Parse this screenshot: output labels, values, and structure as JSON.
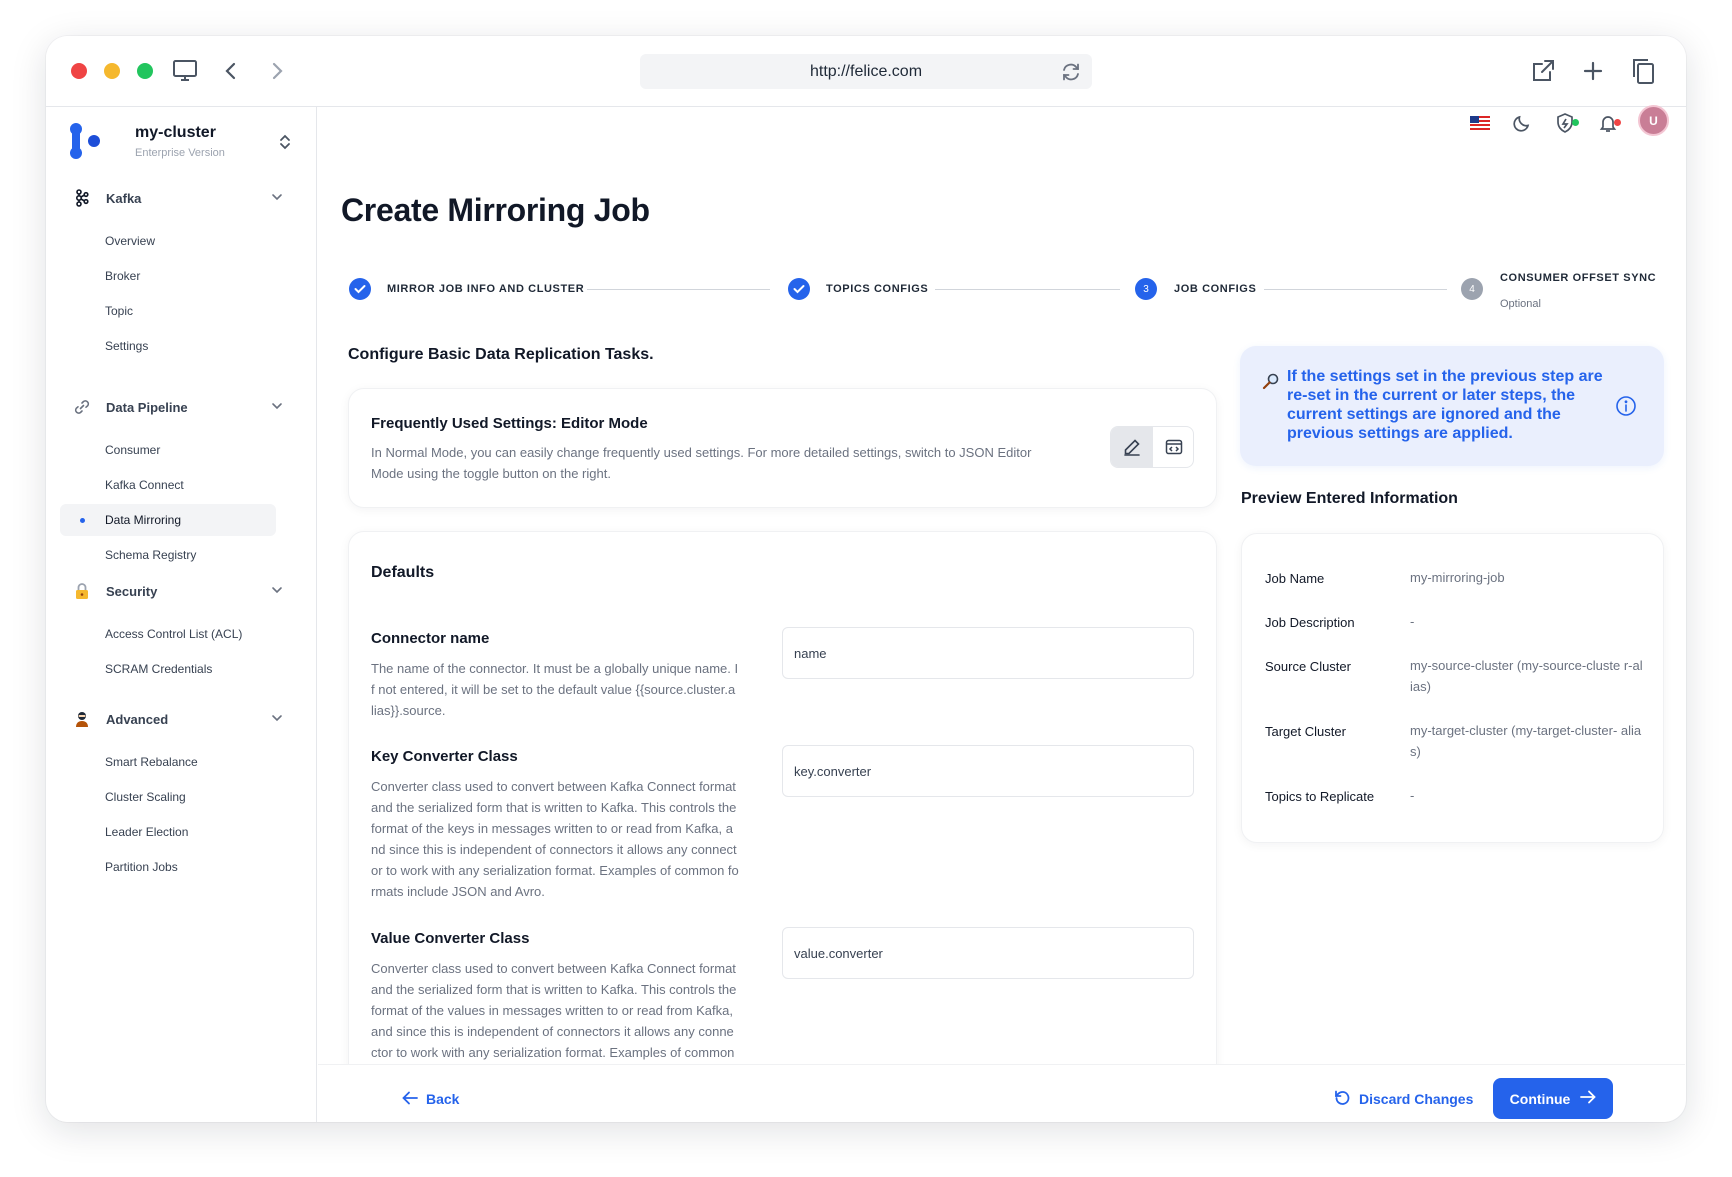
{
  "browser": {
    "url": "http://felice.com"
  },
  "sidebar": {
    "cluster_name": "my-cluster",
    "cluster_edition": "Enterprise Version",
    "sections": [
      {
        "label": "Kafka",
        "items": [
          "Overview",
          "Broker",
          "Topic",
          "Settings"
        ]
      },
      {
        "label": "Data Pipeline",
        "items": [
          "Consumer",
          "Kafka Connect",
          "Data Mirroring",
          "Schema Registry"
        ]
      },
      {
        "label": "Security",
        "items": [
          "Access Control List (ACL)",
          "SCRAM Credentials"
        ]
      },
      {
        "label": "Advanced",
        "items": [
          "Smart Rebalance",
          "Cluster Scaling",
          "Leader Election",
          "Partition Jobs"
        ]
      }
    ],
    "active_item": "Data Mirroring"
  },
  "topbar": {
    "avatar_initial": "U",
    "icons": [
      "us-flag-icon",
      "moon-icon",
      "shield-icon",
      "bell-icon"
    ]
  },
  "page": {
    "title": "Create Mirroring Job"
  },
  "stepper": {
    "steps": [
      {
        "label": "MIRROR JOB INFO AND CLUSTER",
        "status": "done"
      },
      {
        "label": "TOPICS CONFIGS",
        "status": "done"
      },
      {
        "label": "JOB CONFIGS",
        "status": "current",
        "number": "3"
      },
      {
        "label": "CONSUMER OFFSET SYNC",
        "status": "todo",
        "number": "4",
        "sub": "Optional"
      }
    ]
  },
  "main": {
    "section_heading": "Configure Basic Data Replication Tasks.",
    "editor_card": {
      "title": "Frequently Used Settings: Editor Mode",
      "description_line1": "In Normal Mode, you can easily change frequently used settings. For more detailed settings, switch to JSON Editor",
      "description_line2": "Mode using the toggle button on the right."
    },
    "defaults_title": "Defaults",
    "fields": [
      {
        "title": "Connector name",
        "description_lines": [
          "The name of the connector. It must be a globally unique name. I",
          "f not entered, it will be set to the default value {{source.cluster.a",
          "lias}}.source."
        ],
        "value": "name"
      },
      {
        "title": "Key Converter Class",
        "description_lines": [
          "Converter class used to convert between Kafka Connect format",
          "and the serialized form that is written to Kafka. This controls the",
          "format of the keys in messages written to or read from Kafka, a",
          "nd since this is independent of connectors it allows any connect",
          "or to work with any serialization format. Examples of common fo",
          "rmats include JSON and Avro."
        ],
        "value": "key.converter"
      },
      {
        "title": "Value Converter Class",
        "description_lines": [
          "Converter class used to convert between Kafka Connect format",
          "and the serialized form that is written to Kafka. This controls the",
          "format of the values in messages written to or read from Kafka,",
          "and since this is independent of connectors it allows any conne",
          "ctor to work with any serialization format. Examples of common"
        ],
        "value": "value.converter"
      }
    ]
  },
  "info_box": {
    "text": "If the settings set in the previous step are re-set in the current or later steps, the current settings are ignored and the previous settings are applied."
  },
  "preview": {
    "title": "Preview Entered Information",
    "rows": [
      {
        "label": "Job Name",
        "value": "my-mirroring-job"
      },
      {
        "label": "Job Description",
        "value": "-"
      },
      {
        "label": "Source Cluster",
        "value": "my-source-cluster (my-source-cluste r-alias)"
      },
      {
        "label": "Target Cluster",
        "value": "my-target-cluster (my-target-cluster- alias)"
      },
      {
        "label": "Topics to Replicate",
        "value": "-"
      }
    ]
  },
  "footer": {
    "back_label": "Back",
    "discard_label": "Discard Changes",
    "continue_label": "Continue"
  },
  "colors": {
    "accent": "#2563eb",
    "info_bg": "#eaeffd",
    "text_primary": "#111827",
    "text_muted": "#6b7280"
  }
}
